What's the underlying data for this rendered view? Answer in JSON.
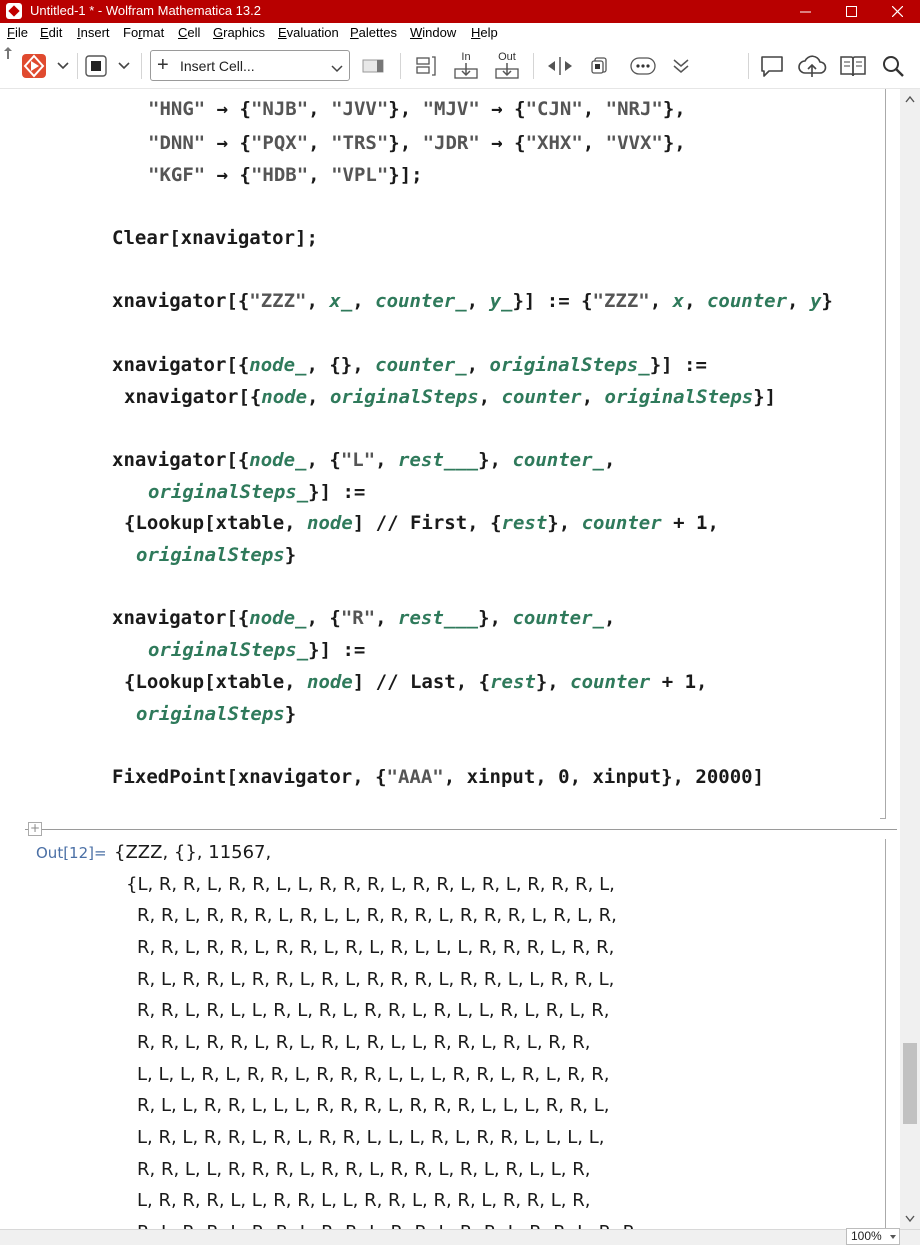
{
  "window": {
    "title": "Untitled-1 * - Wolfram Mathematica 13.2"
  },
  "menu": [
    {
      "label": "File",
      "ul": "F",
      "rest": "ile"
    },
    {
      "label": "Edit",
      "ul": "E",
      "rest": "dit"
    },
    {
      "label": "Insert",
      "ul": "I",
      "rest": "nsert"
    },
    {
      "label": "Format",
      "ul": "F",
      "rest": "o",
      "ul2": "r",
      "rest2": "mat"
    },
    {
      "label": "Cell",
      "ul": "C",
      "rest": "ell"
    },
    {
      "label": "Graphics",
      "ul": "G",
      "rest": "raphics"
    },
    {
      "label": "Evaluation",
      "ul": "E",
      "rest": "valuation"
    },
    {
      "label": "Palettes",
      "ul": "P",
      "rest": "alettes"
    },
    {
      "label": "Window",
      "ul": "W",
      "rest": "indow"
    },
    {
      "label": "Help",
      "ul": "H",
      "rest": "elp"
    }
  ],
  "toolbar": {
    "insert_cell_label": "Insert Cell...",
    "in_label": "In",
    "out_label": "Out"
  },
  "input_lines": [
    "\"HNG\" → {\"NJB\", \"JVV\"}, \"MJV\" → {\"CJN\", \"NRJ\"},",
    "\"DNN\" → {\"PQX\", \"TRS\"}, \"JDR\" → {\"XHX\", \"VVX\"},",
    "\"KGF\" → {\"HDB\", \"VPL\"}];",
    "Clear[xnavigator];",
    "xnavigator[{\"ZZZ\", x_, counter_, y_}] := {\"ZZZ\", x, counter, y}",
    "xnavigator[{node_, {}, counter_, originalSteps_}] :=",
    "xnavigator[{node, originalSteps, counter, originalSteps}]",
    "xnavigator[{node_, {\"L\", rest___}, counter_,",
    "originalSteps_}] :=",
    "{Lookup[xtable, node] // First, {rest}, counter + 1,",
    "originalSteps}",
    "xnavigator[{node_, {\"R\", rest___}, counter_,",
    "originalSteps_}] :=",
    "{Lookup[xtable, node] // Last, {rest}, counter + 1,",
    "originalSteps}",
    "FixedPoint[xnavigator, {\"AAA\", xinput, 0, xinput}, 20000]"
  ],
  "output": {
    "label": "Out[12]=",
    "first_line": "{ZZZ, {}, 11567,",
    "lines": [
      "{L, R, R, L, R, R, L, L, R, R, R, L, R, R, L, R, L, R, R, R, L,",
      "R, R, L, R, R, R, L, R, L, L, R, R, R, L, R, R, R, L, R, L, R,",
      "R, R, L, R, R, L, R, R, L, R, L, R, L, L, L, R, R, R, L, R, R,",
      "R, L, R, R, L, R, R, L, R, L, R, R, R, L, R, R, L, L, R, R, L,",
      "R, R, L, R, L, L, R, L, R, L, R, R, L, R, L, L, R, L, R, L, R,",
      "R, R, L, R, R, L, R, L, R, L, R, L, L, R, R, L, R, L, R, R,",
      "L, L, L, R, L, R, R, L, R, R, R, L, L, L, R, R, L, R, L, R, R,",
      "R, L, L, R, R, L, L, L, R, R, R, L, R, R, R, L, L, L, R, R, L,",
      "L, R, L, R, R, L, R, L, R, R, L, L, L, R, L, R, R, L, L, L, L,",
      "R, R, L, L, R, R, R, L, R, R, L, R, R, L, R, L, R, L, L, R,",
      "L, R, R, R, L, L, R, R, L, L, R, R, L, R, R, L, R, R, L, R,",
      "R, L, R, R, L, R, R, L, R, R, L, R, R, L, R, R, L, R, R, L, R, R"
    ]
  },
  "status": {
    "zoom": "100%"
  }
}
